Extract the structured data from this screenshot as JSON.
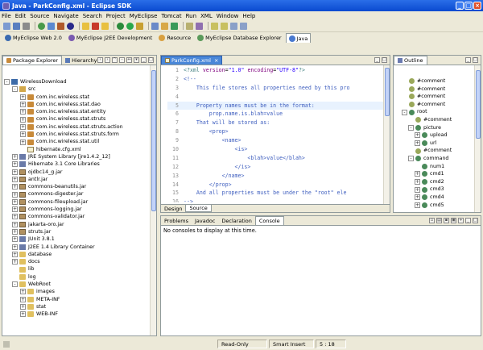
{
  "window": {
    "title": "Java - ParkConfig.xml - Eclipse SDK"
  },
  "menu": [
    "File",
    "Edit",
    "Source",
    "Navigate",
    "Search",
    "Project",
    "MyEclipse",
    "Tomcat",
    "Run",
    "XML",
    "Window",
    "Help"
  ],
  "perspectives": [
    {
      "label": "MyEclipse Web 2.0",
      "active": false
    },
    {
      "label": "MyEclipse J2EE Development",
      "active": false
    },
    {
      "label": "Resource",
      "active": false
    },
    {
      "label": "MyEclipse Database Explorer",
      "active": false
    },
    {
      "label": "Java",
      "active": true
    }
  ],
  "left_view": {
    "tabs": [
      "Package Explorer",
      "Hierarchy"
    ],
    "tree": [
      {
        "label": "WirelessDownload",
        "indent": 0,
        "exp": "-",
        "icon": "proj"
      },
      {
        "label": "src",
        "indent": 1,
        "exp": "-",
        "icon": "srcf"
      },
      {
        "label": "com.inc.wireless.stat",
        "indent": 2,
        "exp": "+",
        "icon": "pkg"
      },
      {
        "label": "com.inc.wireless.stat.dao",
        "indent": 2,
        "exp": "+",
        "icon": "pkg"
      },
      {
        "label": "com.inc.wireless.stat.entity",
        "indent": 2,
        "exp": "+",
        "icon": "pkg"
      },
      {
        "label": "com.inc.wireless.stat.struts",
        "indent": 2,
        "exp": "+",
        "icon": "pkg"
      },
      {
        "label": "com.inc.wireless.stat.struts.action",
        "indent": 2,
        "exp": "+",
        "icon": "pkg"
      },
      {
        "label": "com.inc.wireless.stat.struts.form",
        "indent": 2,
        "exp": "+",
        "icon": "pkg"
      },
      {
        "label": "com.inc.wireless.stat.util",
        "indent": 2,
        "exp": "+",
        "icon": "pkg"
      },
      {
        "label": "hibernate.cfg.xml",
        "indent": 2,
        "exp": "",
        "icon": "xml"
      },
      {
        "label": "JRE System Library [jre1.4.2_12]",
        "indent": 1,
        "exp": "+",
        "icon": "lib"
      },
      {
        "label": "Hibernate 3.1 Core Libraries",
        "indent": 1,
        "exp": "+",
        "icon": "lib"
      },
      {
        "label": "ojdbc14_g.jar",
        "indent": 1,
        "exp": "+",
        "icon": "jar"
      },
      {
        "label": "antlr.jar",
        "indent": 1,
        "exp": "+",
        "icon": "jar"
      },
      {
        "label": "commons-beanutils.jar",
        "indent": 1,
        "exp": "+",
        "icon": "jar"
      },
      {
        "label": "commons-digester.jar",
        "indent": 1,
        "exp": "+",
        "icon": "jar"
      },
      {
        "label": "commons-fileupload.jar",
        "indent": 1,
        "exp": "+",
        "icon": "jar"
      },
      {
        "label": "commons-logging.jar",
        "indent": 1,
        "exp": "+",
        "icon": "jar"
      },
      {
        "label": "commons-validator.jar",
        "indent": 1,
        "exp": "+",
        "icon": "jar"
      },
      {
        "label": "jakarta-oro.jar",
        "indent": 1,
        "exp": "+",
        "icon": "jar"
      },
      {
        "label": "struts.jar",
        "indent": 1,
        "exp": "+",
        "icon": "jar"
      },
      {
        "label": "JUnit 3.8.1",
        "indent": 1,
        "exp": "+",
        "icon": "lib"
      },
      {
        "label": "J2EE 1.4 Library Container",
        "indent": 1,
        "exp": "+",
        "icon": "lib"
      },
      {
        "label": "database",
        "indent": 1,
        "exp": "+",
        "icon": "fold"
      },
      {
        "label": "docs",
        "indent": 1,
        "exp": "+",
        "icon": "fold"
      },
      {
        "label": "lib",
        "indent": 1,
        "exp": "",
        "icon": "fold"
      },
      {
        "label": "log",
        "indent": 1,
        "exp": "",
        "icon": "fold"
      },
      {
        "label": "WebRoot",
        "indent": 1,
        "exp": "-",
        "icon": "fold"
      },
      {
        "label": "images",
        "indent": 2,
        "exp": "+",
        "icon": "fold"
      },
      {
        "label": "META-INF",
        "indent": 2,
        "exp": "+",
        "icon": "fold"
      },
      {
        "label": "stat",
        "indent": 2,
        "exp": "+",
        "icon": "fold"
      },
      {
        "label": "WEB-INF",
        "indent": 2,
        "exp": "+",
        "icon": "fold"
      }
    ]
  },
  "editor": {
    "tab": "ParkConfig.xml",
    "bottom_tabs": [
      "Design",
      "Source"
    ],
    "lines": [
      {
        "n": "1",
        "hl": false,
        "parts": [
          [
            "tag",
            "<?xml "
          ],
          [
            "attr",
            "version"
          ],
          [
            "txt",
            "="
          ],
          [
            "str",
            "\"1.0\""
          ],
          [
            "txt",
            " "
          ],
          [
            "attr",
            "encoding"
          ],
          [
            "txt",
            "="
          ],
          [
            "str",
            "\"UTF-8\""
          ],
          [
            "tag",
            "?>"
          ]
        ]
      },
      {
        "n": "2",
        "hl": false,
        "parts": [
          [
            "com",
            "<!--"
          ]
        ]
      },
      {
        "n": "3",
        "hl": false,
        "parts": [
          [
            "com",
            "    This file stores all properties need by this pro"
          ]
        ]
      },
      {
        "n": "4",
        "hl": false,
        "parts": [
          [
            "com",
            ""
          ]
        ]
      },
      {
        "n": "5",
        "hl": true,
        "parts": [
          [
            "com",
            "    Property names must be in the format:"
          ]
        ]
      },
      {
        "n": "6",
        "hl": false,
        "parts": [
          [
            "com",
            "        prop.name.is.blah=value"
          ]
        ]
      },
      {
        "n": "7",
        "hl": false,
        "parts": [
          [
            "com",
            "    That will be stored as:"
          ]
        ]
      },
      {
        "n": "8",
        "hl": false,
        "parts": [
          [
            "com",
            "        <prop>"
          ]
        ]
      },
      {
        "n": "9",
        "hl": false,
        "parts": [
          [
            "com",
            "            <name>"
          ]
        ]
      },
      {
        "n": "10",
        "hl": false,
        "parts": [
          [
            "com",
            "                <is>"
          ]
        ]
      },
      {
        "n": "11",
        "hl": false,
        "parts": [
          [
            "com",
            "                    <blah>value</blah>"
          ]
        ]
      },
      {
        "n": "12",
        "hl": false,
        "parts": [
          [
            "com",
            "                </is>"
          ]
        ]
      },
      {
        "n": "13",
        "hl": false,
        "parts": [
          [
            "com",
            "            </name>"
          ]
        ]
      },
      {
        "n": "14",
        "hl": false,
        "parts": [
          [
            "com",
            "        </prop>"
          ]
        ]
      },
      {
        "n": "15",
        "hl": false,
        "parts": [
          [
            "com",
            "    And all properties must be under the \"root\" ele"
          ]
        ]
      },
      {
        "n": "16",
        "hl": false,
        "parts": [
          [
            "com",
            "-->"
          ]
        ]
      }
    ]
  },
  "outline": {
    "tab": "Outline",
    "items": [
      {
        "label": "#comment",
        "indent": 0,
        "exp": "",
        "icon": "com"
      },
      {
        "label": "#comment",
        "indent": 0,
        "exp": "",
        "icon": "com"
      },
      {
        "label": "#comment",
        "indent": 0,
        "exp": "",
        "icon": "com"
      },
      {
        "label": "#comment",
        "indent": 0,
        "exp": "",
        "icon": "com"
      },
      {
        "label": "root",
        "indent": 0,
        "exp": "-",
        "icon": "el"
      },
      {
        "label": "#comment",
        "indent": 1,
        "exp": "",
        "icon": "com"
      },
      {
        "label": "picture",
        "indent": 1,
        "exp": "-",
        "icon": "el"
      },
      {
        "label": "upload",
        "indent": 2,
        "exp": "+",
        "icon": "el"
      },
      {
        "label": "url",
        "indent": 2,
        "exp": "+",
        "icon": "el"
      },
      {
        "label": "#comment",
        "indent": 1,
        "exp": "",
        "icon": "com"
      },
      {
        "label": "command",
        "indent": 1,
        "exp": "-",
        "icon": "el"
      },
      {
        "label": "num1",
        "indent": 2,
        "exp": "",
        "icon": "el"
      },
      {
        "label": "cmd1",
        "indent": 2,
        "exp": "+",
        "icon": "el"
      },
      {
        "label": "cmd2",
        "indent": 2,
        "exp": "+",
        "icon": "el"
      },
      {
        "label": "cmd3",
        "indent": 2,
        "exp": "+",
        "icon": "el"
      },
      {
        "label": "cmd4",
        "indent": 2,
        "exp": "+",
        "icon": "el"
      },
      {
        "label": "cmd5",
        "indent": 2,
        "exp": "+",
        "icon": "el"
      }
    ]
  },
  "console": {
    "tabs": [
      "Problems",
      "Javadoc",
      "Declaration",
      "Console"
    ],
    "active": "Console",
    "message": "No consoles to display at this time."
  },
  "status": {
    "mode": "Read-Only",
    "insert": "Smart Insert",
    "position": "5 : 18"
  },
  "colors": {
    "title": "#0a4ad0",
    "chrome": "#ece9d8",
    "editor_tab": "#4a87d8",
    "comment": "#3f5fbf",
    "highlight": "#e8f2fe"
  }
}
